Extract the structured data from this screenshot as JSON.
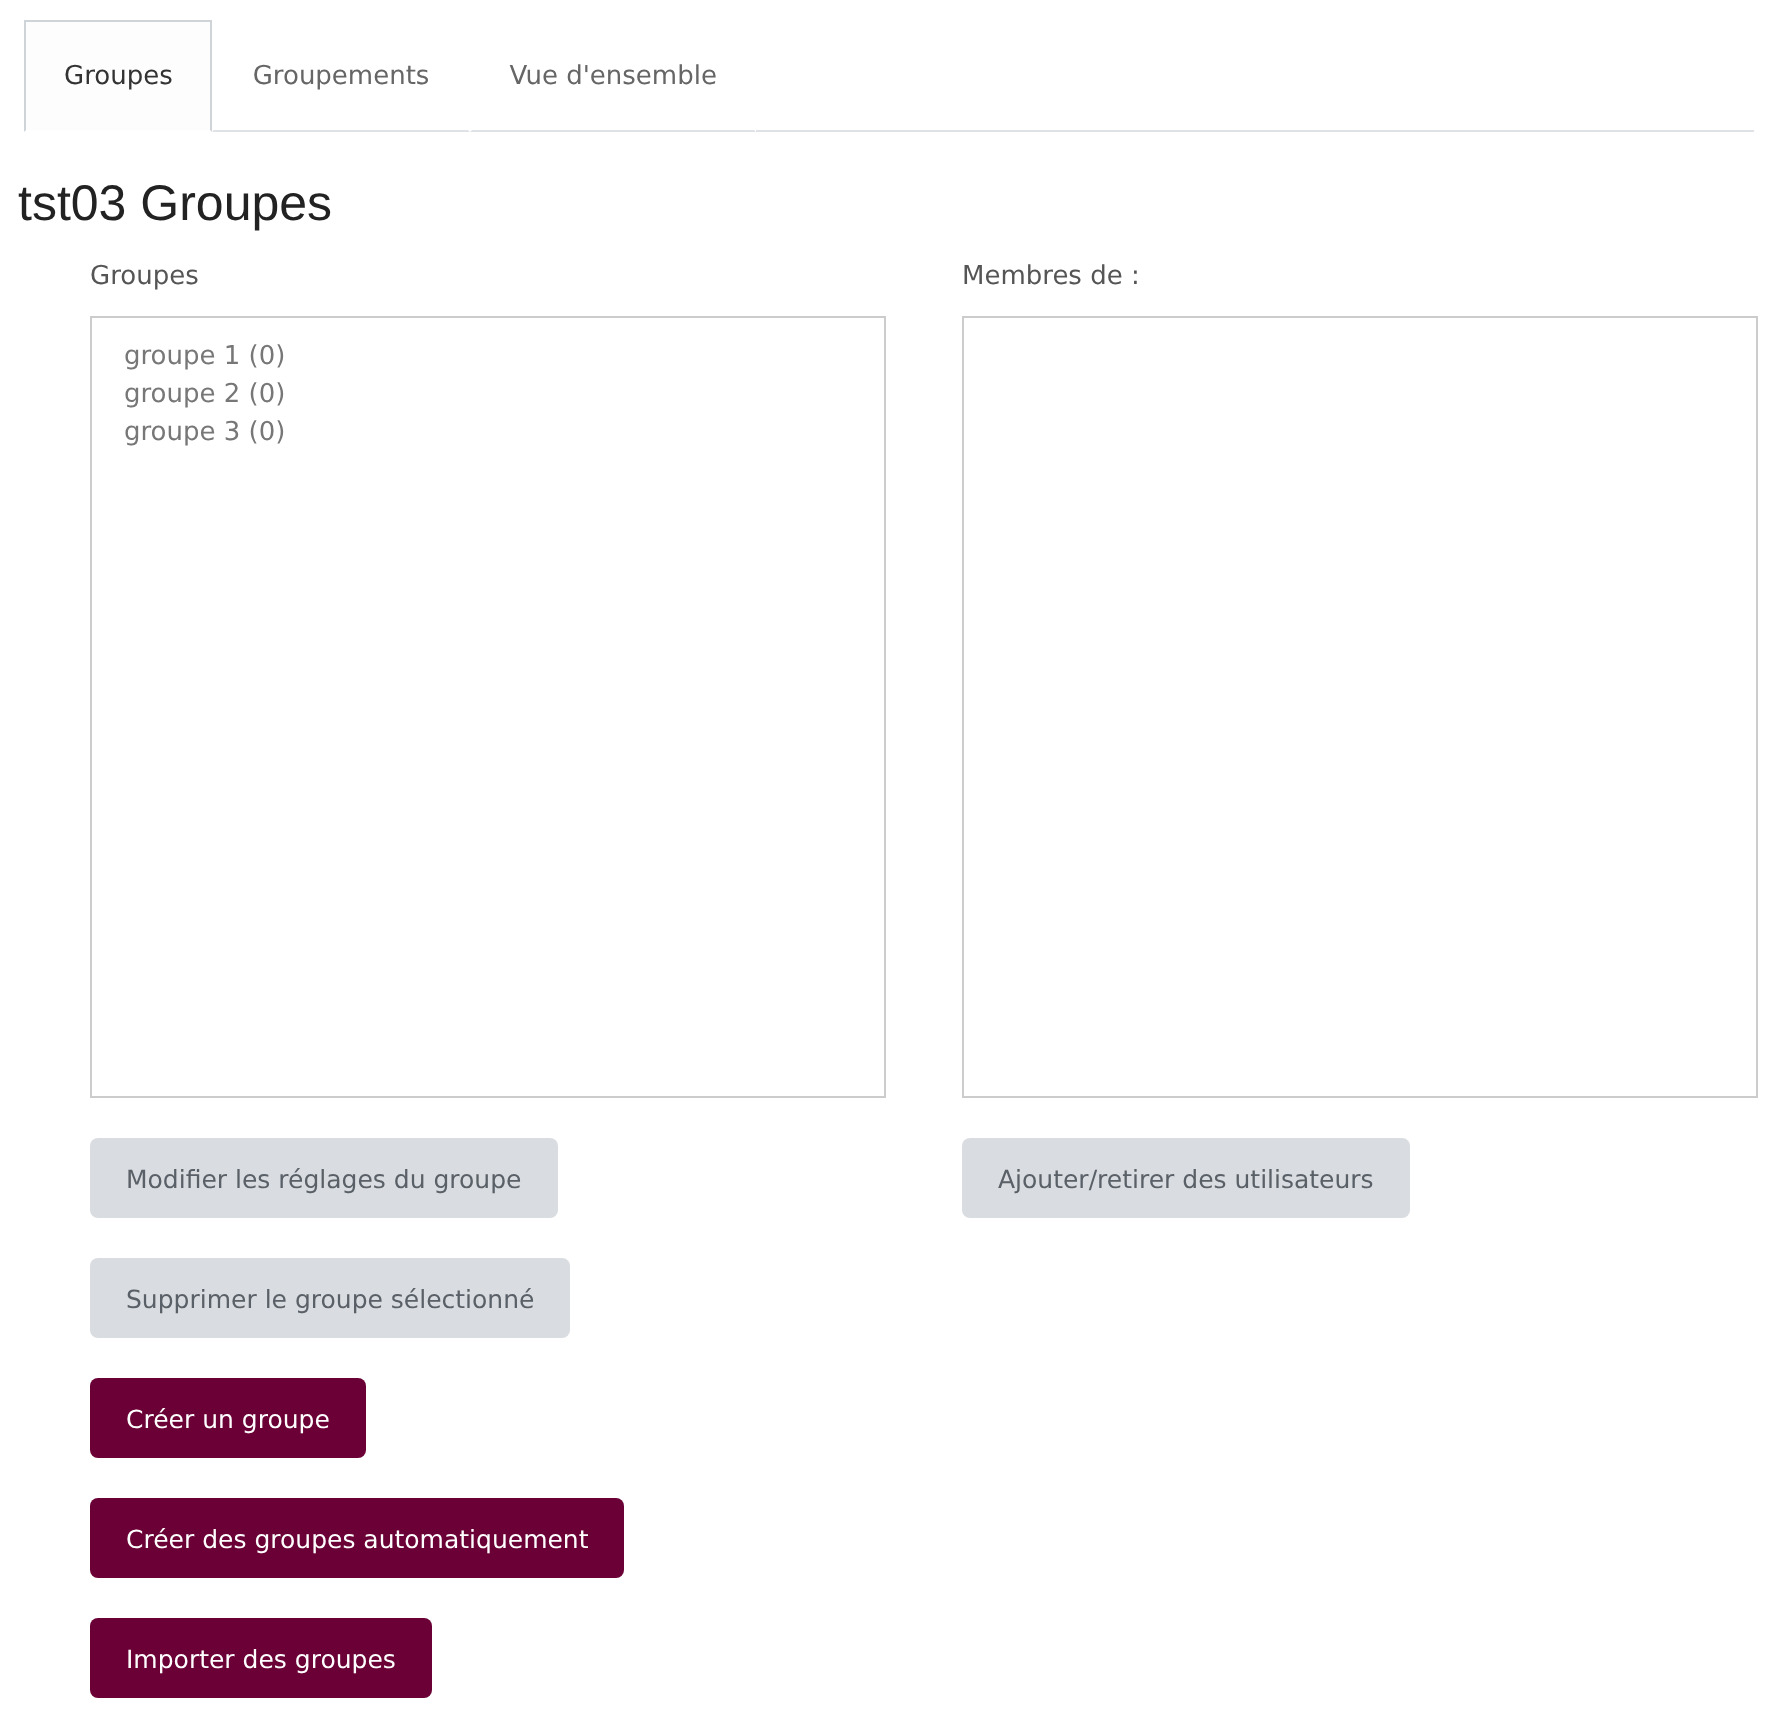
{
  "tabs": [
    {
      "label": "Groupes",
      "selected": true
    },
    {
      "label": "Groupements",
      "selected": false
    },
    {
      "label": "Vue d'ensemble",
      "selected": false
    }
  ],
  "title": "tst03 Groupes",
  "groups_panel": {
    "label": "Groupes",
    "items": [
      "groupe 1 (0)",
      "groupe 2 (0)",
      "groupe 3 (0)"
    ]
  },
  "members_panel": {
    "label": "Membres de :"
  },
  "left_buttons": [
    {
      "label": "Modifier les réglages du groupe",
      "disabled": true
    },
    {
      "label": "Supprimer le groupe sélectionné",
      "disabled": true
    }
  ],
  "right_buttons": [
    {
      "label": "Ajouter/retirer des utilisateurs",
      "disabled": true
    }
  ],
  "actions": [
    {
      "label": "Créer un groupe",
      "disabled": false
    },
    {
      "label": "Créer des groupes automatiquement",
      "disabled": false
    },
    {
      "label": "Importer des groupes",
      "disabled": false
    }
  ]
}
